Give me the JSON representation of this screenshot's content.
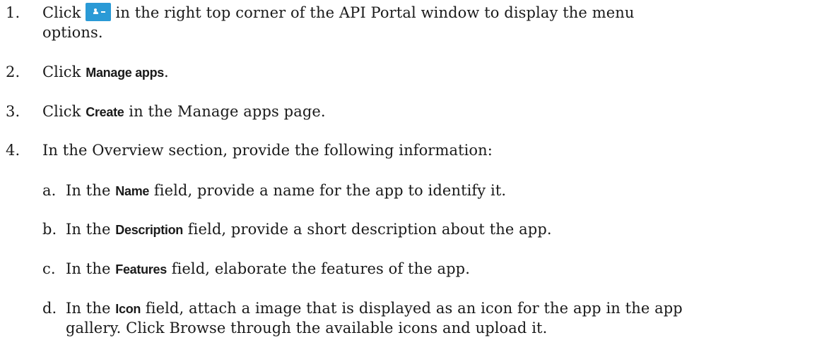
{
  "steps": [
    {
      "number": "1.",
      "before_icon": "Click",
      "icon": "user-menu-icon",
      "after_icon": "in the right top corner of the API Portal window to display the menu",
      "continuation": "options."
    },
    {
      "number": "2.",
      "before": "Click",
      "ui": "Manage apps",
      "after": "."
    },
    {
      "number": "3.",
      "before": "Click",
      "ui": "Create",
      "after": "in the Manage apps page."
    },
    {
      "number": "4.",
      "text": "In the Overview section, provide the following information:"
    }
  ],
  "substeps": [
    {
      "letter": "a.",
      "before": "In the",
      "ui": "Name",
      "after": "field, provide a name for the app to identify it."
    },
    {
      "letter": "b.",
      "before": "In the",
      "ui": "Description",
      "after": "field, provide a short description about the app."
    },
    {
      "letter": "c.",
      "before": "In the",
      "ui": "Features",
      "after": "field, elaborate the features of the app."
    },
    {
      "letter": "d.",
      "before": "In the",
      "ui": "Icon",
      "after": "field, attach a image that is displayed as an icon for the app in the app",
      "continuation": "gallery. Click Browse through the available icons and upload it."
    }
  ],
  "colors": {
    "icon_button": "#2a9ad6",
    "text": "#1a1a1a"
  }
}
